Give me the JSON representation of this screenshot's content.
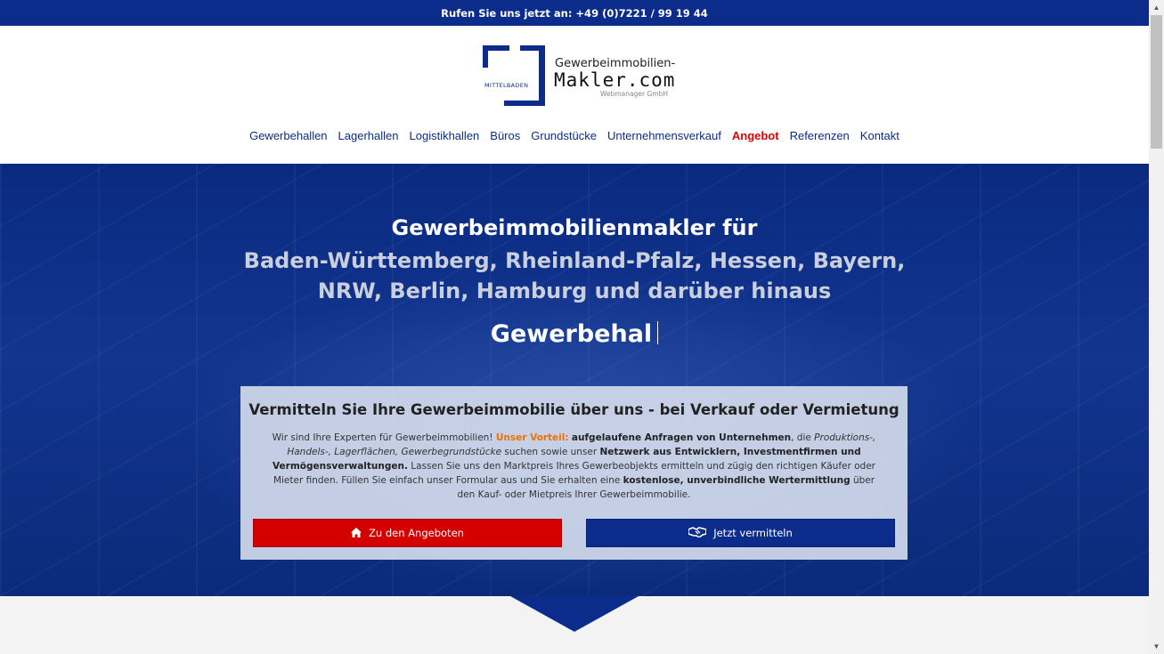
{
  "topbar": {
    "call_text": "Rufen Sie uns jetzt an: +49 (0)7221 / 99 19 44"
  },
  "logo": {
    "badge": "MITTELBADEN",
    "line1": "Gewerbeimmobilien-",
    "line2": "Makler.com",
    "line3": "Webmanager GmbH"
  },
  "nav": {
    "items": [
      {
        "label": "Gewerbehallen"
      },
      {
        "label": "Lagerhallen"
      },
      {
        "label": "Logistikhallen"
      },
      {
        "label": "Büros"
      },
      {
        "label": "Grundstücke"
      },
      {
        "label": "Unternehmensverkauf"
      },
      {
        "label": "Angebot",
        "highlight_color": "#e00000"
      },
      {
        "label": "Referenzen"
      },
      {
        "label": "Kontakt"
      }
    ]
  },
  "hero": {
    "title": "Gewerbeimmobilienmakler für",
    "regions": "Baden-Württemberg, Rheinland-Pfalz, Hessen, Bayern, NRW, Berlin, Hamburg und darüber hinaus",
    "typed_text": "Gewerbehal"
  },
  "card": {
    "title": "Vermitteln Sie Ihre Gewerbeimmobilie über uns - bei Verkauf oder Vermietung",
    "text": {
      "t1": "Wir sind Ihre Experten für Gewerbeimmobilien! ",
      "advantage_label": "Unser Vorteil:",
      "t2": " ",
      "b1": "aufgelaufene Anfragen von Unternehmen",
      "t3": ", die ",
      "i1": "Produktions-, Handels-, Lagerflächen, Gewerbegrundstücke",
      "t4": " suchen sowie unser ",
      "b2": "Netzwerk aus Entwicklern, Investmentfirmen und Vermögensverwaltungen.",
      "t5": " Lassen Sie uns den Marktpreis Ihres Gewerbeobjekts ermitteln und zügig den richtigen Käufer oder Mieter finden. Füllen Sie einfach unser Formular aus und Sie erhalten eine ",
      "b3": "kostenlose, unverbindliche Wertermittlung",
      "t6": " über den Kauf- oder Mietpreis Ihrer Gewerbeimmobilie."
    },
    "buttons": {
      "offers": {
        "label": "Zu den Angeboten",
        "icon": "home-icon",
        "color": "#d40000"
      },
      "broker": {
        "label": "Jetzt vermitteln",
        "icon": "handshake-icon",
        "color": "#0c2c8c"
      }
    }
  },
  "colors": {
    "brand_blue": "#0c2c8c",
    "accent_red": "#d40000",
    "accent_orange": "#f07000"
  }
}
